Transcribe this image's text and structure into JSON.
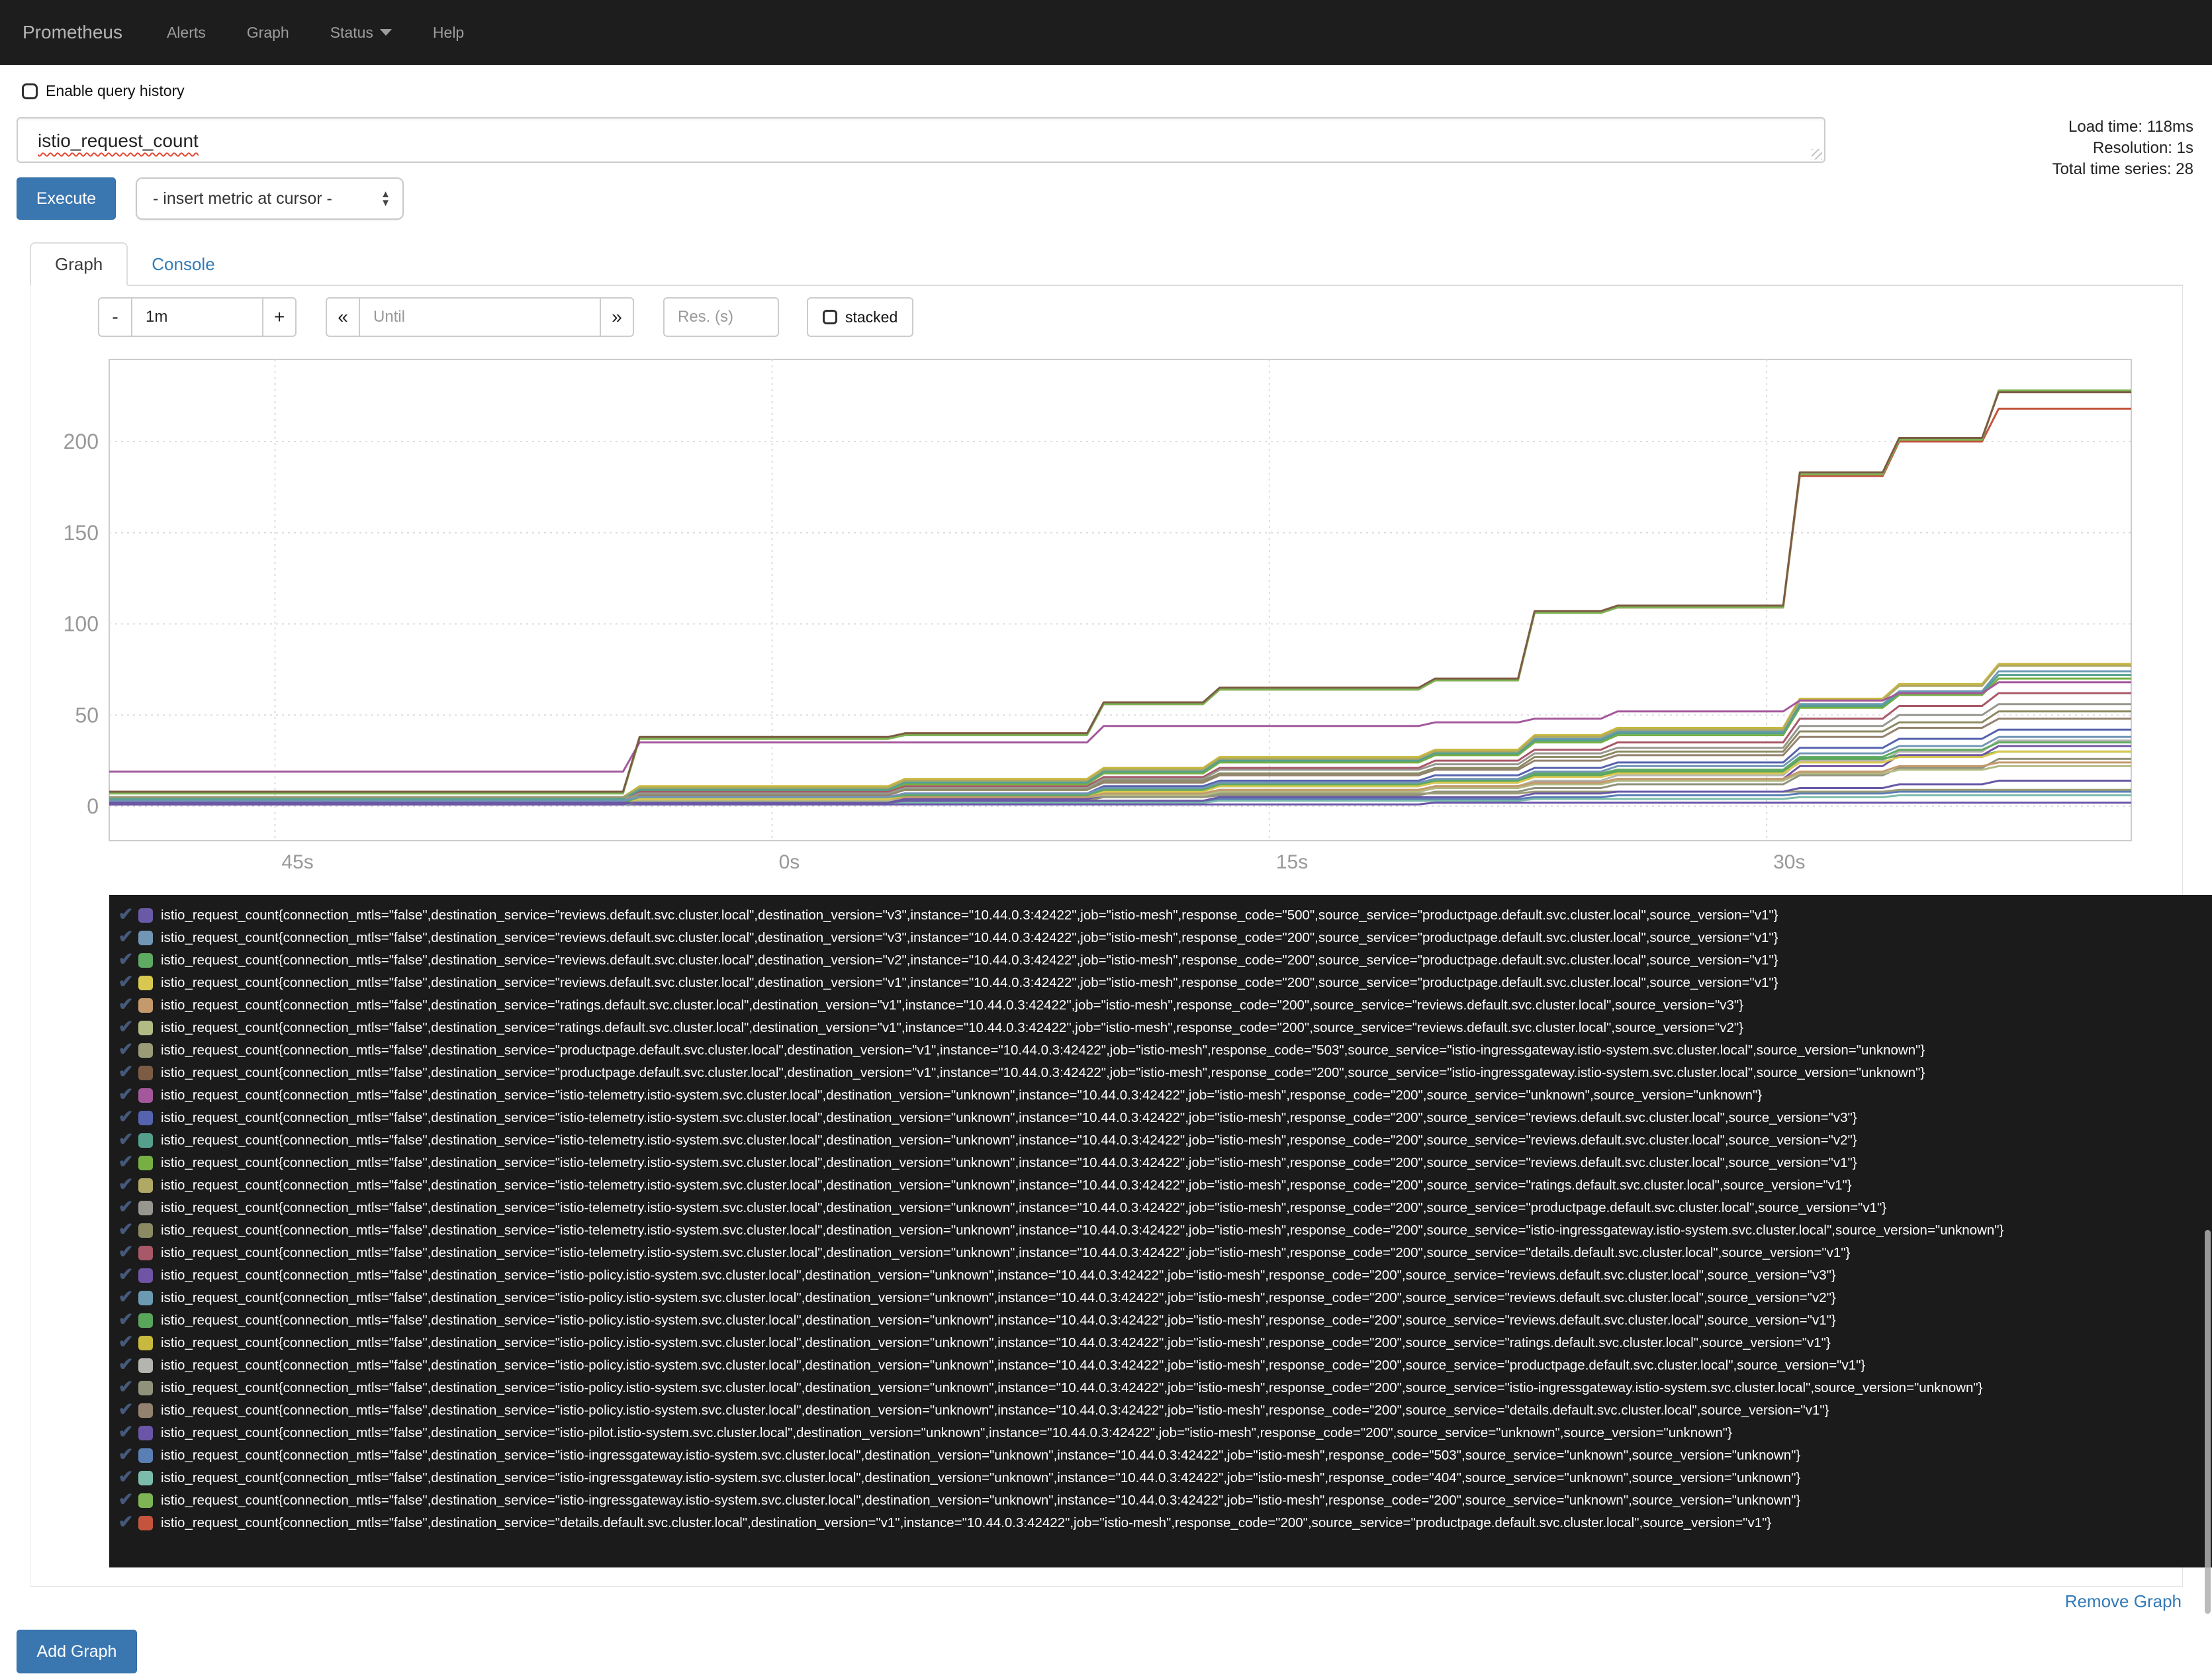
{
  "navbar": {
    "brand": "Prometheus",
    "items": [
      {
        "label": "Alerts",
        "caret": false
      },
      {
        "label": "Graph",
        "caret": false
      },
      {
        "label": "Status",
        "caret": true
      },
      {
        "label": "Help",
        "caret": false
      }
    ]
  },
  "query": {
    "history_label": "Enable query history",
    "value": "istio_request_count",
    "execute_label": "Execute",
    "metric_select_label": "- insert metric at cursor -"
  },
  "stats": {
    "load_time": "Load time: 118ms",
    "resolution": "Resolution: 1s",
    "total_series": "Total time series: 28"
  },
  "tabs": {
    "graph": "Graph",
    "console": "Console"
  },
  "controls": {
    "minus": "-",
    "range_value": "1m",
    "plus": "+",
    "rewind": "«",
    "until_placeholder": "Until",
    "forward": "»",
    "res_placeholder": "Res. (s)",
    "stacked_label": "stacked"
  },
  "footer": {
    "remove_graph": "Remove Graph",
    "add_graph": "Add Graph"
  },
  "chart_data": {
    "type": "line",
    "metric": "istio_request_count",
    "grid": true,
    "legend_position": "bottom",
    "ylim": [
      0,
      245
    ],
    "yticks": [
      0,
      50,
      100,
      150,
      200
    ],
    "x_range_seconds": [
      -20,
      41
    ],
    "xticks": [
      {
        "t": -15,
        "label": "45s"
      },
      {
        "t": 0,
        "label": "0s"
      },
      {
        "t": 15,
        "label": "15s"
      },
      {
        "t": 30,
        "label": "30s"
      }
    ],
    "breakpoints": [
      -20,
      -4.5,
      -4,
      3.5,
      4,
      9.5,
      10,
      13,
      13.5,
      19.5,
      20,
      22.5,
      23,
      25,
      25.5,
      30.5,
      31,
      33.5,
      34,
      36.5,
      37,
      41
    ],
    "series": [
      {
        "levels": [
          2,
          2,
          3,
          3,
          5,
          5,
          7,
          8,
          10,
          12,
          14
        ]
      },
      {
        "levels": [
          3,
          5,
          7,
          10,
          13,
          15,
          19,
          22,
          29,
          33,
          38
        ]
      },
      {
        "levels": [
          2,
          5,
          6,
          9,
          12,
          14,
          18,
          20,
          27,
          31,
          35
        ]
      },
      {
        "levels": [
          2,
          4,
          6,
          8,
          11,
          13,
          16,
          18,
          24,
          27,
          30
        ]
      },
      {
        "levels": [
          2,
          4,
          5,
          7,
          9,
          11,
          13,
          15,
          19,
          22,
          24
        ]
      },
      {
        "levels": [
          2,
          3,
          5,
          6,
          8,
          10,
          12,
          14,
          18,
          20,
          22
        ]
      },
      {
        "levels": [
          5,
          5,
          6,
          6,
          7,
          7,
          8,
          8,
          8,
          9,
          9
        ]
      },
      {
        "levels": [
          8,
          38,
          40,
          57,
          65,
          70,
          107,
          110,
          183,
          202,
          227
        ]
      },
      {
        "levels": [
          19,
          35,
          35,
          44,
          44,
          46,
          48,
          52,
          58,
          62,
          68
        ]
      },
      {
        "levels": [
          2,
          5,
          7,
          11,
          14,
          17,
          21,
          24,
          32,
          37,
          42
        ]
      },
      {
        "levels": [
          4,
          9,
          13,
          19,
          25,
          29,
          36,
          40,
          55,
          62,
          72
        ]
      },
      {
        "levels": [
          4,
          9,
          12,
          18,
          24,
          28,
          35,
          39,
          54,
          61,
          70
        ]
      },
      {
        "levels": [
          5,
          10,
          14,
          20,
          26,
          30,
          38,
          42,
          58,
          66,
          77
        ]
      },
      {
        "levels": [
          3,
          7,
          10,
          15,
          20,
          23,
          29,
          32,
          44,
          50,
          56
        ]
      },
      {
        "levels": [
          3,
          7,
          9,
          14,
          18,
          21,
          27,
          30,
          41,
          46,
          52
        ]
      },
      {
        "levels": [
          3,
          8,
          11,
          16,
          21,
          25,
          31,
          35,
          48,
          55,
          62
        ]
      },
      {
        "levels": [
          1,
          3,
          4,
          6,
          8,
          10,
          13,
          15,
          22,
          28,
          33
        ]
      },
      {
        "levels": [
          4,
          10,
          13,
          19,
          25,
          29,
          37,
          41,
          56,
          63,
          74
        ]
      },
      {
        "levels": [
          2,
          4,
          6,
          9,
          11,
          13,
          17,
          19,
          26,
          28,
          30
        ]
      },
      {
        "levels": [
          5,
          11,
          15,
          21,
          27,
          31,
          39,
          43,
          59,
          67,
          78
        ]
      },
      {
        "levels": [
          1,
          3,
          5,
          7,
          9,
          11,
          14,
          17,
          25,
          30,
          36
        ]
      },
      {
        "levels": [
          1,
          2,
          3,
          5,
          6,
          8,
          10,
          12,
          17,
          21,
          26
        ]
      },
      {
        "levels": [
          2,
          6,
          9,
          13,
          17,
          20,
          25,
          28,
          38,
          43,
          48
        ]
      },
      {
        "levels": [
          1,
          1,
          1,
          1,
          1,
          2,
          2,
          2,
          2,
          2,
          2
        ]
      },
      {
        "levels": [
          2,
          2,
          3,
          3,
          4,
          4,
          5,
          6,
          7,
          8,
          8
        ]
      },
      {
        "levels": [
          1,
          1,
          2,
          2,
          3,
          3,
          4,
          4,
          5,
          6,
          6
        ]
      },
      {
        "levels": [
          7,
          37,
          39,
          56,
          64,
          69,
          106,
          109,
          182,
          201,
          228
        ]
      },
      {
        "levels": [
          8,
          37,
          40,
          56,
          64,
          69,
          106,
          109,
          181,
          200,
          218
        ]
      }
    ]
  },
  "legend": {
    "entries": [
      {
        "color": "#6959a6",
        "label": "istio_request_count{connection_mtls=\"false\",destination_service=\"reviews.default.svc.cluster.local\",destination_version=\"v3\",instance=\"10.44.0.3:42422\",job=\"istio-mesh\",response_code=\"500\",source_service=\"productpage.default.svc.cluster.local\",source_version=\"v1\"}"
      },
      {
        "color": "#7296b5",
        "label": "istio_request_count{connection_mtls=\"false\",destination_service=\"reviews.default.svc.cluster.local\",destination_version=\"v3\",instance=\"10.44.0.3:42422\",job=\"istio-mesh\",response_code=\"200\",source_service=\"productpage.default.svc.cluster.local\",source_version=\"v1\"}"
      },
      {
        "color": "#5faa62",
        "label": "istio_request_count{connection_mtls=\"false\",destination_service=\"reviews.default.svc.cluster.local\",destination_version=\"v2\",instance=\"10.44.0.3:42422\",job=\"istio-mesh\",response_code=\"200\",source_service=\"productpage.default.svc.cluster.local\",source_version=\"v1\"}"
      },
      {
        "color": "#d9c84f",
        "label": "istio_request_count{connection_mtls=\"false\",destination_service=\"reviews.default.svc.cluster.local\",destination_version=\"v1\",instance=\"10.44.0.3:42422\",job=\"istio-mesh\",response_code=\"200\",source_service=\"productpage.default.svc.cluster.local\",source_version=\"v1\"}"
      },
      {
        "color": "#c49a6c",
        "label": "istio_request_count{connection_mtls=\"false\",destination_service=\"ratings.default.svc.cluster.local\",destination_version=\"v1\",instance=\"10.44.0.3:42422\",job=\"istio-mesh\",response_code=\"200\",source_service=\"reviews.default.svc.cluster.local\",source_version=\"v3\"}"
      },
      {
        "color": "#b3bb85",
        "label": "istio_request_count{connection_mtls=\"false\",destination_service=\"ratings.default.svc.cluster.local\",destination_version=\"v1\",instance=\"10.44.0.3:42422\",job=\"istio-mesh\",response_code=\"200\",source_service=\"reviews.default.svc.cluster.local\",source_version=\"v2\"}"
      },
      {
        "color": "#9b9b78",
        "label": "istio_request_count{connection_mtls=\"false\",destination_service=\"productpage.default.svc.cluster.local\",destination_version=\"v1\",instance=\"10.44.0.3:42422\",job=\"istio-mesh\",response_code=\"503\",source_service=\"istio-ingressgateway.istio-system.svc.cluster.local\",source_version=\"unknown\"}"
      },
      {
        "color": "#7c5c44",
        "label": "istio_request_count{connection_mtls=\"false\",destination_service=\"productpage.default.svc.cluster.local\",destination_version=\"v1\",instance=\"10.44.0.3:42422\",job=\"istio-mesh\",response_code=\"200\",source_service=\"istio-ingressgateway.istio-system.svc.cluster.local\",source_version=\"unknown\"}"
      },
      {
        "color": "#a4589c",
        "label": "istio_request_count{connection_mtls=\"false\",destination_service=\"istio-telemetry.istio-system.svc.cluster.local\",destination_version=\"unknown\",instance=\"10.44.0.3:42422\",job=\"istio-mesh\",response_code=\"200\",source_service=\"unknown\",source_version=\"unknown\"}"
      },
      {
        "color": "#5663ae",
        "label": "istio_request_count{connection_mtls=\"false\",destination_service=\"istio-telemetry.istio-system.svc.cluster.local\",destination_version=\"unknown\",instance=\"10.44.0.3:42422\",job=\"istio-mesh\",response_code=\"200\",source_service=\"reviews.default.svc.cluster.local\",source_version=\"v3\"}"
      },
      {
        "color": "#55a08d",
        "label": "istio_request_count{connection_mtls=\"false\",destination_service=\"istio-telemetry.istio-system.svc.cluster.local\",destination_version=\"unknown\",instance=\"10.44.0.3:42422\",job=\"istio-mesh\",response_code=\"200\",source_service=\"reviews.default.svc.cluster.local\",source_version=\"v2\"}"
      },
      {
        "color": "#76b043",
        "label": "istio_request_count{connection_mtls=\"false\",destination_service=\"istio-telemetry.istio-system.svc.cluster.local\",destination_version=\"unknown\",instance=\"10.44.0.3:42422\",job=\"istio-mesh\",response_code=\"200\",source_service=\"reviews.default.svc.cluster.local\",source_version=\"v1\"}"
      },
      {
        "color": "#b0a865",
        "label": "istio_request_count{connection_mtls=\"false\",destination_service=\"istio-telemetry.istio-system.svc.cluster.local\",destination_version=\"unknown\",instance=\"10.44.0.3:42422\",job=\"istio-mesh\",response_code=\"200\",source_service=\"ratings.default.svc.cluster.local\",source_version=\"v1\"}"
      },
      {
        "color": "#97978f",
        "label": "istio_request_count{connection_mtls=\"false\",destination_service=\"istio-telemetry.istio-system.svc.cluster.local\",destination_version=\"unknown\",instance=\"10.44.0.3:42422\",job=\"istio-mesh\",response_code=\"200\",source_service=\"productpage.default.svc.cluster.local\",source_version=\"v1\"}"
      },
      {
        "color": "#8c8a62",
        "label": "istio_request_count{connection_mtls=\"false\",destination_service=\"istio-telemetry.istio-system.svc.cluster.local\",destination_version=\"unknown\",instance=\"10.44.0.3:42422\",job=\"istio-mesh\",response_code=\"200\",source_service=\"istio-ingressgateway.istio-system.svc.cluster.local\",source_version=\"unknown\"}"
      },
      {
        "color": "#a85868",
        "label": "istio_request_count{connection_mtls=\"false\",destination_service=\"istio-telemetry.istio-system.svc.cluster.local\",destination_version=\"unknown\",instance=\"10.44.0.3:42422\",job=\"istio-mesh\",response_code=\"200\",source_service=\"details.default.svc.cluster.local\",source_version=\"v1\"}"
      },
      {
        "color": "#7054a5",
        "label": "istio_request_count{connection_mtls=\"false\",destination_service=\"istio-policy.istio-system.svc.cluster.local\",destination_version=\"unknown\",instance=\"10.44.0.3:42422\",job=\"istio-mesh\",response_code=\"200\",source_service=\"reviews.default.svc.cluster.local\",source_version=\"v3\"}"
      },
      {
        "color": "#6b9ab2",
        "label": "istio_request_count{connection_mtls=\"false\",destination_service=\"istio-policy.istio-system.svc.cluster.local\",destination_version=\"unknown\",instance=\"10.44.0.3:42422\",job=\"istio-mesh\",response_code=\"200\",source_service=\"reviews.default.svc.cluster.local\",source_version=\"v2\"}"
      },
      {
        "color": "#5aa55c",
        "label": "istio_request_count{connection_mtls=\"false\",destination_service=\"istio-policy.istio-system.svc.cluster.local\",destination_version=\"unknown\",instance=\"10.44.0.3:42422\",job=\"istio-mesh\",response_code=\"200\",source_service=\"reviews.default.svc.cluster.local\",source_version=\"v1\"}"
      },
      {
        "color": "#c7b83e",
        "label": "istio_request_count{connection_mtls=\"false\",destination_service=\"istio-policy.istio-system.svc.cluster.local\",destination_version=\"unknown\",instance=\"10.44.0.3:42422\",job=\"istio-mesh\",response_code=\"200\",source_service=\"ratings.default.svc.cluster.local\",source_version=\"v1\"}"
      },
      {
        "color": "#b5b5b0",
        "label": "istio_request_count{connection_mtls=\"false\",destination_service=\"istio-policy.istio-system.svc.cluster.local\",destination_version=\"unknown\",instance=\"10.44.0.3:42422\",job=\"istio-mesh\",response_code=\"200\",source_service=\"productpage.default.svc.cluster.local\",source_version=\"v1\"}"
      },
      {
        "color": "#90927b",
        "label": "istio_request_count{connection_mtls=\"false\",destination_service=\"istio-policy.istio-system.svc.cluster.local\",destination_version=\"unknown\",instance=\"10.44.0.3:42422\",job=\"istio-mesh\",response_code=\"200\",source_service=\"istio-ingressgateway.istio-system.svc.cluster.local\",source_version=\"unknown\"}"
      },
      {
        "color": "#93826f",
        "label": "istio_request_count{connection_mtls=\"false\",destination_service=\"istio-policy.istio-system.svc.cluster.local\",destination_version=\"unknown\",instance=\"10.44.0.3:42422\",job=\"istio-mesh\",response_code=\"200\",source_service=\"details.default.svc.cluster.local\",source_version=\"v1\"}"
      },
      {
        "color": "#6a55a8",
        "label": "istio_request_count{connection_mtls=\"false\",destination_service=\"istio-pilot.istio-system.svc.cluster.local\",destination_version=\"unknown\",instance=\"10.44.0.3:42422\",job=\"istio-mesh\",response_code=\"200\",source_service=\"unknown\",source_version=\"unknown\"}"
      },
      {
        "color": "#5a7fb5",
        "label": "istio_request_count{connection_mtls=\"false\",destination_service=\"istio-ingressgateway.istio-system.svc.cluster.local\",destination_version=\"unknown\",instance=\"10.44.0.3:42422\",job=\"istio-mesh\",response_code=\"503\",source_service=\"unknown\",source_version=\"unknown\"}"
      },
      {
        "color": "#7cbcab",
        "label": "istio_request_count{connection_mtls=\"false\",destination_service=\"istio-ingressgateway.istio-system.svc.cluster.local\",destination_version=\"unknown\",instance=\"10.44.0.3:42422\",job=\"istio-mesh\",response_code=\"404\",source_service=\"unknown\",source_version=\"unknown\"}"
      },
      {
        "color": "#7db554",
        "label": "istio_request_count{connection_mtls=\"false\",destination_service=\"istio-ingressgateway.istio-system.svc.cluster.local\",destination_version=\"unknown\",instance=\"10.44.0.3:42422\",job=\"istio-mesh\",response_code=\"200\",source_service=\"unknown\",source_version=\"unknown\"}"
      },
      {
        "color": "#c4543e",
        "label": "istio_request_count{connection_mtls=\"false\",destination_service=\"details.default.svc.cluster.local\",destination_version=\"v1\",instance=\"10.44.0.3:42422\",job=\"istio-mesh\",response_code=\"200\",source_service=\"productpage.default.svc.cluster.local\",source_version=\"v1\"}"
      }
    ]
  }
}
